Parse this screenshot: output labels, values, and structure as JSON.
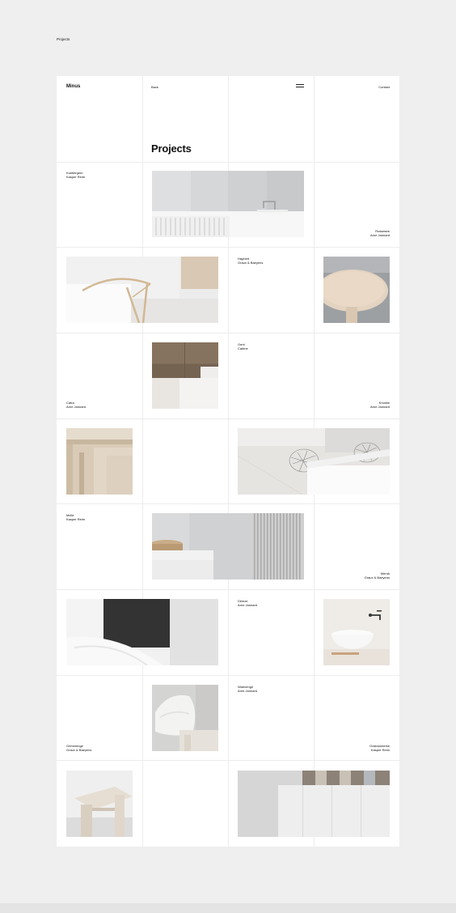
{
  "page_label": "Projects",
  "header": {
    "brand": "Minus",
    "back_label": "Back",
    "contact_label": "Contact",
    "title": "Projects"
  },
  "projects": [
    {
      "name": "Koetlergem",
      "designer": "Kasper Reim"
    },
    {
      "name": "Rossesee",
      "designer": "Arne Jannard"
    },
    {
      "name": "Hapbert",
      "designer": "Graux & Baeyens"
    },
    {
      "name": "Gent",
      "designer": "Cabine"
    },
    {
      "name": "Catra",
      "designer": "Arne Jannard"
    },
    {
      "name": "Knokke",
      "designer": "Arne Jannard"
    },
    {
      "name": "Melle",
      "designer": "Kasper Reim"
    },
    {
      "name": "Merok",
      "designer": "Graux & Baeyens"
    },
    {
      "name": "Deinze",
      "designer": "Arne Jannard"
    },
    {
      "name": "Waenenge",
      "designer": "Arne Jannard"
    },
    {
      "name": "Grimmenge",
      "designer": "Graux & Baeyens"
    },
    {
      "name": "Oostdunkerke",
      "designer": "Kasper Reim"
    }
  ],
  "images": [
    {
      "icon": "kitchen-counter-image"
    },
    {
      "icon": "wishbone-chair-image"
    },
    {
      "icon": "round-table-image"
    },
    {
      "icon": "wood-cabinet-image"
    },
    {
      "icon": "wood-corridor-image"
    },
    {
      "icon": "wire-chairs-image"
    },
    {
      "icon": "bathroom-vanity-image"
    },
    {
      "icon": "bathtub-image"
    },
    {
      "icon": "wall-faucet-basin-image"
    },
    {
      "icon": "cushion-sofa-image"
    },
    {
      "icon": "wood-stool-image"
    },
    {
      "icon": "white-cabinets-image"
    }
  ]
}
